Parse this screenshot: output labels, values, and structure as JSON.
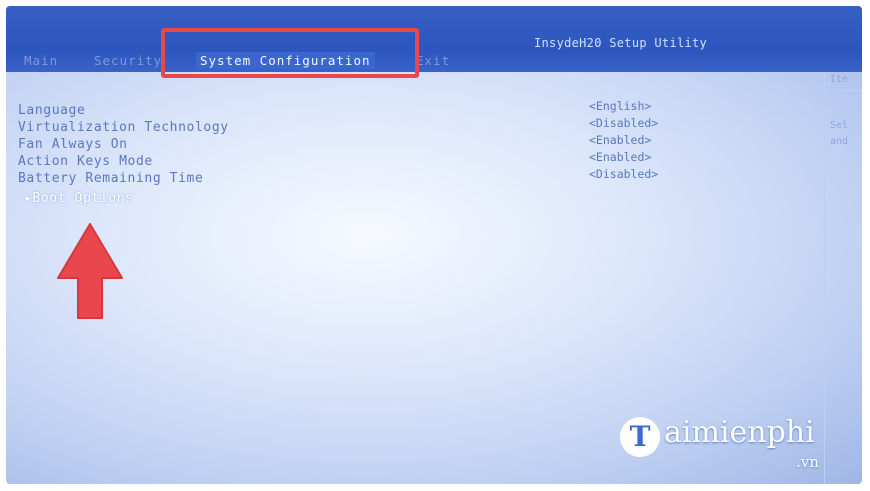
{
  "header": {
    "title": "InsydeH20 Setup Utility"
  },
  "menu": {
    "items": [
      {
        "label": "Main"
      },
      {
        "label": "Security"
      },
      {
        "label": "System Configuration",
        "selected": true
      },
      {
        "label": "Exit"
      }
    ]
  },
  "settings": [
    {
      "label": "Language",
      "value": "<English>"
    },
    {
      "label": "Virtualization Technology",
      "value": "<Disabled>"
    },
    {
      "label": "Fan Always On",
      "value": "<Enabled>"
    },
    {
      "label": "Action Keys Mode",
      "value": "<Enabled>"
    },
    {
      "label": "Battery Remaining Time",
      "value": "<Disabled>"
    },
    {
      "label": "▸Boot Options",
      "selected": true
    }
  ],
  "help_panel": {
    "heading": "Ite",
    "lines": [
      "Sel",
      "and"
    ]
  },
  "watermark": {
    "logo_letter": "T",
    "name": "aimienphi",
    "domain": ".vn"
  },
  "colors": {
    "menu_bar": "#2c56bc",
    "screen_bg": "#dde7fb",
    "text": "#5a77c0",
    "selected_text": "#ffffff",
    "highlight_box": "#e8474c",
    "arrow": "#e8474c"
  },
  "icons": {
    "annotation_arrow": "red-up-arrow"
  }
}
